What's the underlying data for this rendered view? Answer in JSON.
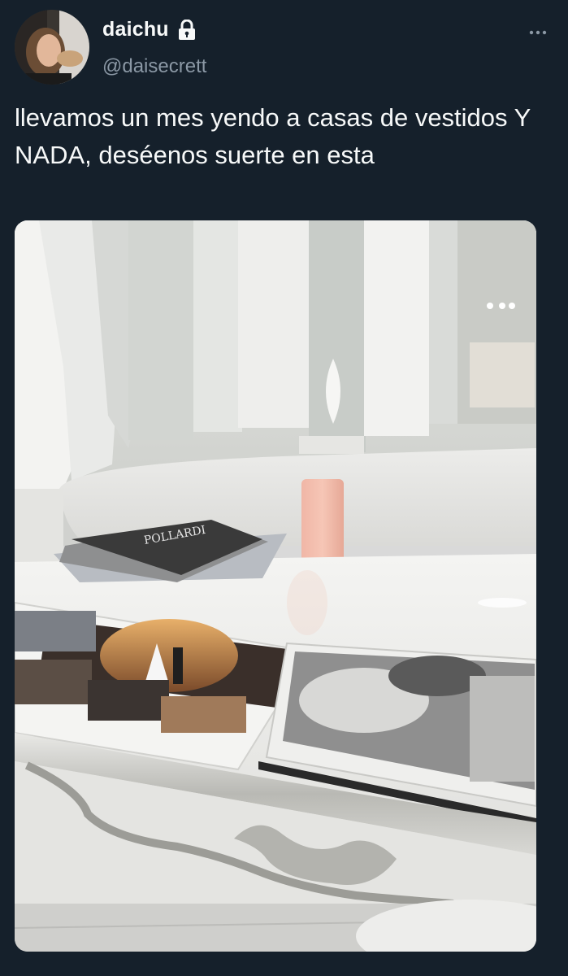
{
  "tweet": {
    "display_name": "daichu",
    "protected_icon": "lock-icon",
    "handle": "@daisecrett",
    "more_icon": "ellipsis-icon",
    "text": "llevamos un mes yendo a casas de vestidos Y NADA, deséenos suerte en esta",
    "media": {
      "magazine_title": "POLLARDI"
    }
  },
  "colors": {
    "background": "#15202b",
    "primary_text": "#f7f9f9",
    "secondary_text": "#8b98a5"
  }
}
